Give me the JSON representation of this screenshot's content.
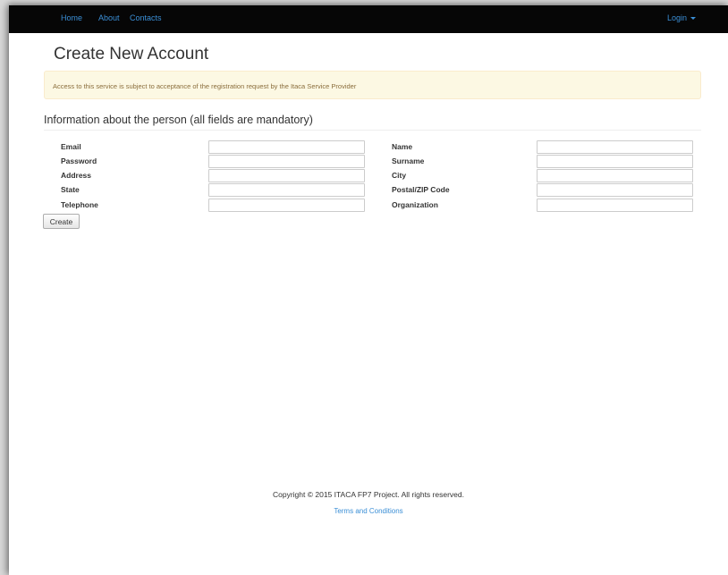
{
  "nav": {
    "items": [
      {
        "label": "Home"
      },
      {
        "label": "About"
      },
      {
        "label": "Contacts"
      }
    ],
    "login_label": "Login"
  },
  "page": {
    "title": "Create New Account",
    "alert": "Access to this service is subject to acceptance of the registration request by the Itaca Service Provider",
    "section_title": "Information about the person (all fields are mandatory)"
  },
  "form": {
    "left": [
      {
        "label": "Email",
        "value": ""
      },
      {
        "label": "Password",
        "value": ""
      },
      {
        "label": "Address",
        "value": ""
      },
      {
        "label": "State",
        "value": ""
      },
      {
        "label": "Telephone",
        "value": ""
      }
    ],
    "right": [
      {
        "label": "Name",
        "value": ""
      },
      {
        "label": "Surname",
        "value": ""
      },
      {
        "label": "City",
        "value": ""
      },
      {
        "label": "Postal/ZIP Code",
        "value": ""
      },
      {
        "label": "Organization",
        "value": ""
      }
    ],
    "submit_label": "Create"
  },
  "footer": {
    "copyright": "Copyright © 2015 ITACA FP7 Project. All rights reserved.",
    "terms_label": "Terms and Conditions"
  },
  "colors": {
    "navbar_bg": "#060606",
    "link": "#3b8fd6",
    "alert_bg": "#fcf8e3",
    "alert_text": "#8a6d3b"
  }
}
